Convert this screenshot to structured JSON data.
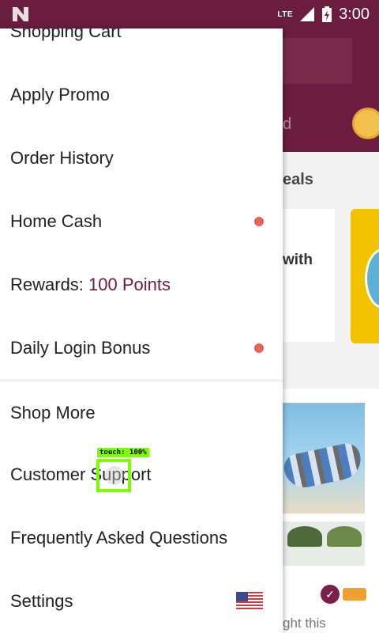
{
  "status_bar": {
    "network": "LTE",
    "time": "3:00"
  },
  "drawer": {
    "items": [
      {
        "label": "Shopping Cart"
      },
      {
        "label": "Apply Promo"
      },
      {
        "label": "Order History"
      },
      {
        "label": "Home Cash",
        "has_dot": true
      },
      {
        "label_prefix": "Rewards: ",
        "label_points": "100 Points"
      },
      {
        "label": "Daily Login Bonus",
        "has_dot": true
      },
      {
        "label": "Shop More"
      },
      {
        "label": "Customer Support"
      },
      {
        "label": "Frequently Asked Questions"
      },
      {
        "label": "Settings"
      }
    ]
  },
  "background_app": {
    "search_hint": "..",
    "header_text": "d",
    "section_title": "eals",
    "deal_text": "with",
    "footer_text": "ght this"
  },
  "touch_overlay": {
    "label": "touch: 100%"
  },
  "colors": {
    "primary": "#6b1d3f",
    "notification_dot": "#e8605a",
    "touch_highlight": "#7dff00"
  }
}
